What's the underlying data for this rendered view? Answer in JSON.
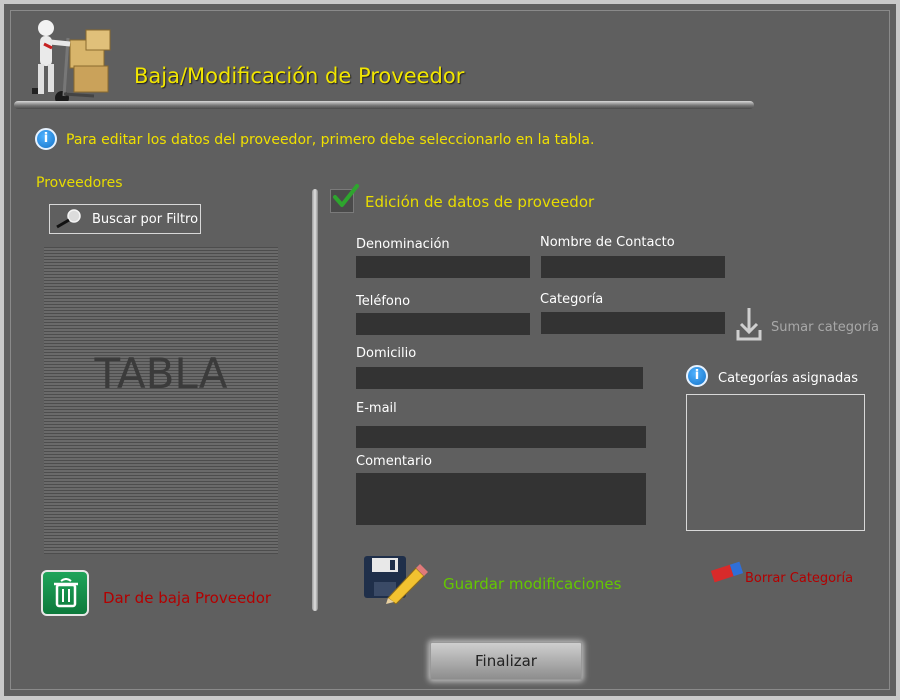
{
  "header": {
    "title": "Baja/Modificación de Proveedor"
  },
  "hint": {
    "text": "Para editar los datos del proveedor, primero debe seleccionarlo en la tabla."
  },
  "left_panel": {
    "section_label": "Proveedores",
    "filter_button_label": "Buscar por Filtro",
    "table_placeholder": "TABLA",
    "delete_label": "Dar de baja Proveedor"
  },
  "form": {
    "edit_toggle_label": "Edición de datos de proveedor",
    "edit_toggle_checked": true,
    "fields": {
      "denominacion": "Denominación",
      "nombre_contacto": "Nombre de Contacto",
      "telefono": "Teléfono",
      "categoria": "Categoría",
      "domicilio": "Domicilio",
      "email": "E-mail",
      "comentario": "Comentario"
    },
    "add_category_label": "Sumar categoría",
    "assigned_categories_label": "Categorías asignadas",
    "save_label": "Guardar modificaciones",
    "delete_category_label": "Borrar Categoría"
  },
  "footer": {
    "finish_label": "Finalizar"
  },
  "colors": {
    "background": "#5f5f5f",
    "title": "#f2e600",
    "accent_yellow": "#e8dc00",
    "danger_red": "#b30000",
    "save_green": "#64c800",
    "field_bg": "#333333"
  }
}
